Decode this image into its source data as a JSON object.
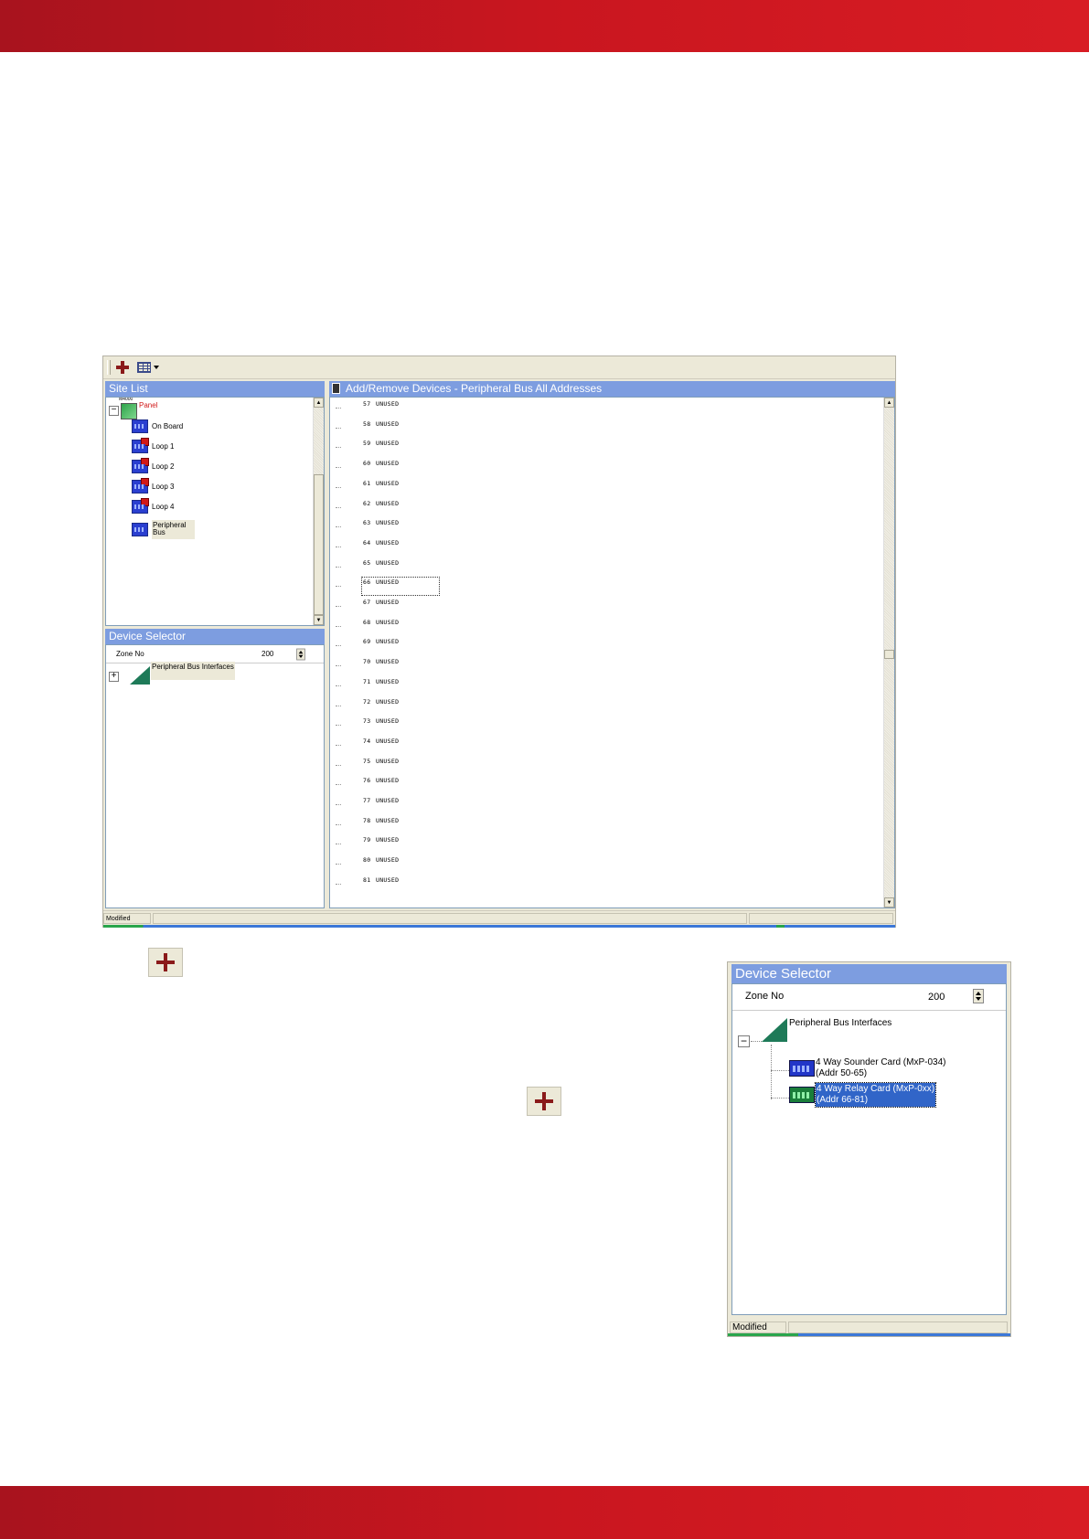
{
  "window": {
    "site_list_title": "Site List",
    "device_selector_title": "Device Selector",
    "main_title": "Add/Remove Devices -  Peripheral Bus  All Addresses",
    "tree": {
      "panel": "Panel",
      "panel_badge": "M4000",
      "onboard": "On Board",
      "loop1": "Loop 1",
      "loop2": "Loop 2",
      "loop3": "Loop 3",
      "loop4": "Loop 4",
      "peripheral": "Peripheral Bus"
    },
    "zone_label": "Zone No",
    "zone_value": "200",
    "ds_item": "Peripheral Bus Interfaces",
    "addresses": [
      {
        "num": "57",
        "status": "UNUSED"
      },
      {
        "num": "58",
        "status": "UNUSED"
      },
      {
        "num": "59",
        "status": "UNUSED"
      },
      {
        "num": "60",
        "status": "UNUSED"
      },
      {
        "num": "61",
        "status": "UNUSED"
      },
      {
        "num": "62",
        "status": "UNUSED"
      },
      {
        "num": "63",
        "status": "UNUSED"
      },
      {
        "num": "64",
        "status": "UNUSED"
      },
      {
        "num": "65",
        "status": "UNUSED"
      },
      {
        "num": "66",
        "status": "UNUSED"
      },
      {
        "num": "67",
        "status": "UNUSED"
      },
      {
        "num": "68",
        "status": "UNUSED"
      },
      {
        "num": "69",
        "status": "UNUSED"
      },
      {
        "num": "70",
        "status": "UNUSED"
      },
      {
        "num": "71",
        "status": "UNUSED"
      },
      {
        "num": "72",
        "status": "UNUSED"
      },
      {
        "num": "73",
        "status": "UNUSED"
      },
      {
        "num": "74",
        "status": "UNUSED"
      },
      {
        "num": "75",
        "status": "UNUSED"
      },
      {
        "num": "76",
        "status": "UNUSED"
      },
      {
        "num": "77",
        "status": "UNUSED"
      },
      {
        "num": "78",
        "status": "UNUSED"
      },
      {
        "num": "79",
        "status": "UNUSED"
      },
      {
        "num": "80",
        "status": "UNUSED"
      },
      {
        "num": "81",
        "status": "UNUSED"
      }
    ],
    "status_text": "Modified"
  },
  "inset": {
    "title": "Device Selector",
    "zone_label": "Zone No",
    "zone_value": "200",
    "group": "Peripheral Bus Interfaces",
    "sounder_line1": "4 Way Sounder Card (MxP-034)",
    "sounder_line2": "(Addr 50-65)",
    "relay_line1": "4 Way Relay Card   (MxP-0xx)",
    "relay_line2": "(Addr 66-81)",
    "status_text": "Modified"
  },
  "colors": {
    "band": "#c9161f",
    "title_bar": "#7d9de0",
    "selection": "#3165c8"
  }
}
